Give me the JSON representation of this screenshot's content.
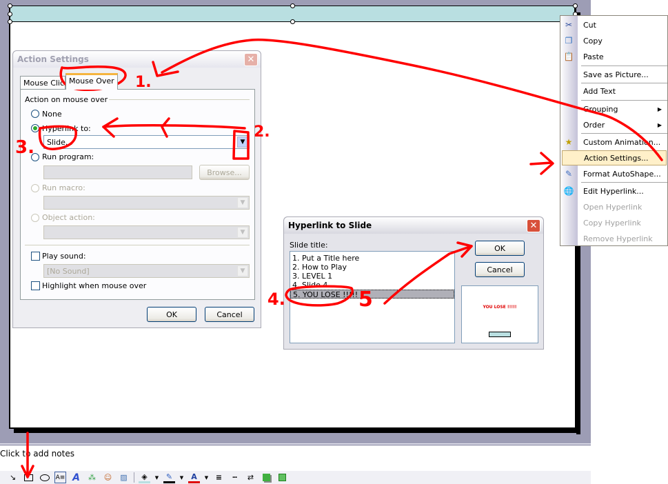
{
  "notes": {
    "placeholder": "Click to add notes"
  },
  "action_settings": {
    "title": "Action Settings",
    "tabs": [
      {
        "label": "Mouse Click",
        "active": false
      },
      {
        "label": "Mouse Over",
        "active": true
      }
    ],
    "group_label": "Action on mouse over",
    "options": {
      "none": "None",
      "hyperlink": "Hyperlink to:",
      "run_program": "Run program:",
      "run_macro": "Run macro:",
      "object_action": "Object action:"
    },
    "selected_option": "hyperlink",
    "hyperlink_value": "Slide...",
    "browse_label": "Browse...",
    "play_sound_label": "Play sound:",
    "play_sound_checked": false,
    "sound_value": "[No Sound]",
    "highlight_label": "Highlight when mouse over",
    "highlight_checked": false,
    "ok_label": "OK",
    "cancel_label": "Cancel"
  },
  "hyperlink_to_slide": {
    "title": "Hyperlink to Slide",
    "list_label": "Slide title:",
    "slides": [
      "1. Put a Title here",
      "2. How to Play",
      "3. LEVEL 1",
      "4. Slide 4",
      "5. YOU LOSE !!!!!"
    ],
    "selected_index": 4,
    "preview_text": "YOU LOSE !!!!!",
    "preview_text_color": "#e00000",
    "ok_label": "OK",
    "cancel_label": "Cancel"
  },
  "context_menu": {
    "items": [
      {
        "label": "Cut",
        "icon": "scissors",
        "enabled": true
      },
      {
        "label": "Copy",
        "icon": "copy",
        "enabled": true
      },
      {
        "label": "Paste",
        "icon": "paste",
        "enabled": true
      },
      {
        "label": "Save as Picture...",
        "enabled": true
      },
      {
        "label": "Add Text",
        "enabled": true
      },
      {
        "label": "Grouping",
        "submenu": true,
        "enabled": true
      },
      {
        "label": "Order",
        "submenu": true,
        "enabled": true
      },
      {
        "label": "Custom Animation...",
        "icon": "animation",
        "enabled": true
      },
      {
        "label": "Action Settings...",
        "highlighted": true,
        "enabled": true
      },
      {
        "label": "Format AutoShape...",
        "icon": "format",
        "enabled": true
      },
      {
        "label": "Edit Hyperlink...",
        "icon": "hyperlink",
        "enabled": true
      },
      {
        "label": "Open Hyperlink",
        "enabled": false
      },
      {
        "label": "Copy Hyperlink",
        "enabled": false
      },
      {
        "label": "Remove Hyperlink",
        "enabled": false
      }
    ]
  },
  "drawing_toolbar": {
    "tools": [
      "select-arrow",
      "rectangle",
      "oval",
      "text-box",
      "wordart",
      "diagram",
      "clip-art",
      "picture",
      "fill-color",
      "line-color",
      "font-color",
      "line-style",
      "dash-style",
      "arrow-style",
      "shadow",
      "3d"
    ]
  },
  "annotations": {
    "color": "#ff0000",
    "labels": [
      "1.",
      "2.",
      "3.",
      "4.",
      "5"
    ]
  }
}
